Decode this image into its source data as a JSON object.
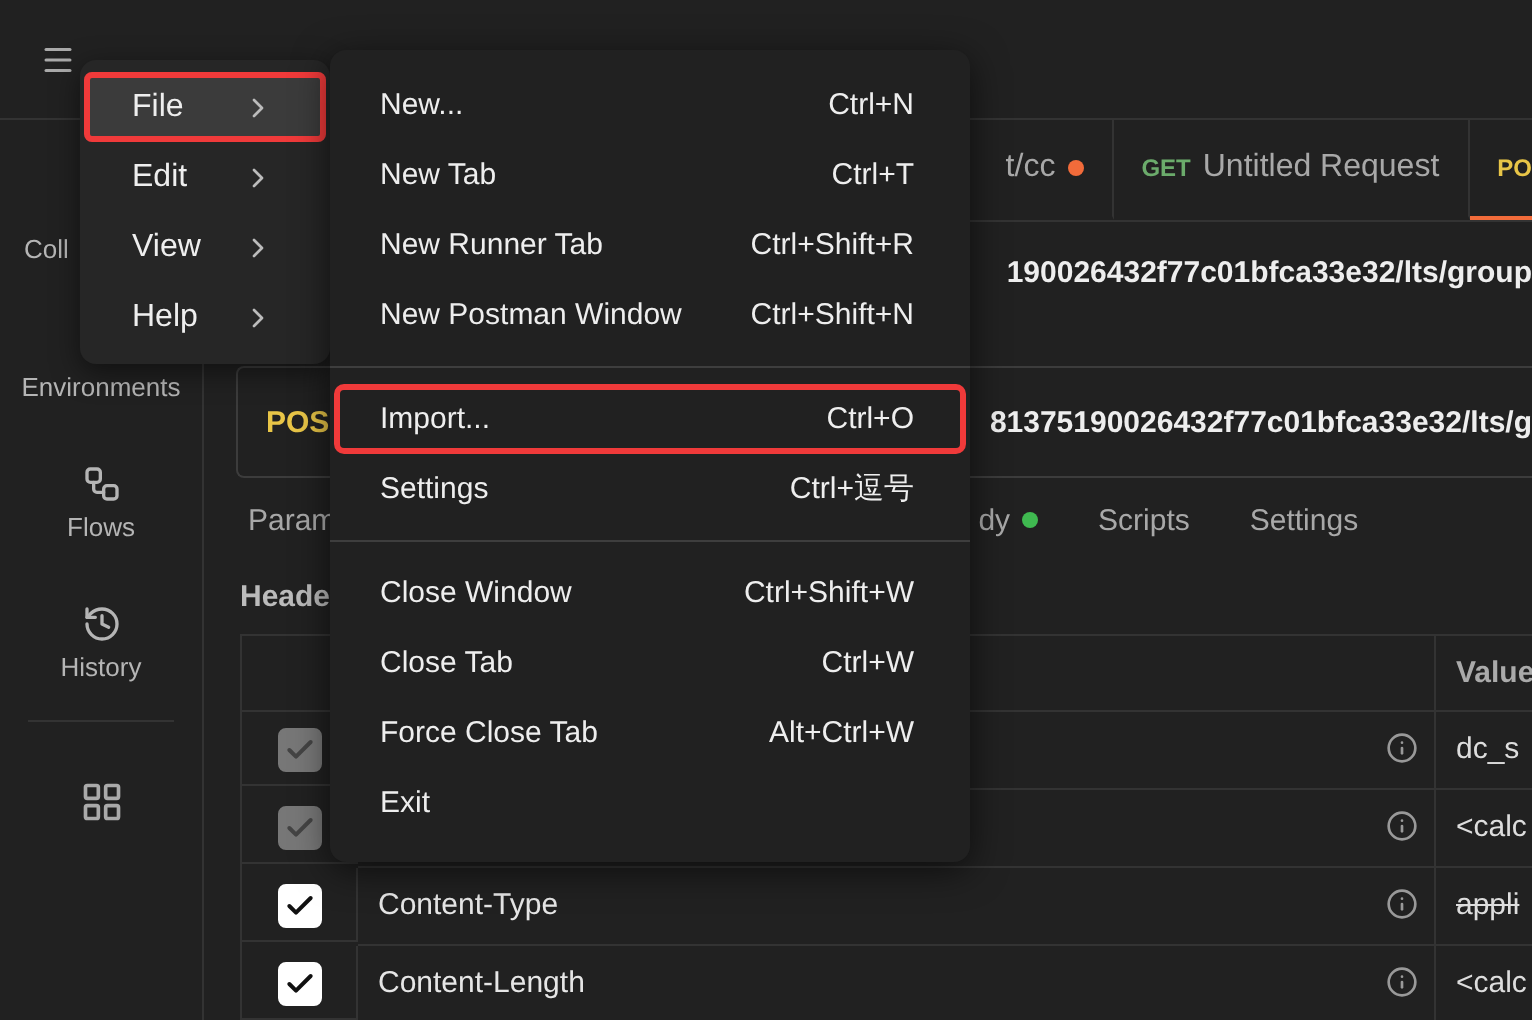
{
  "sidebar": {
    "items": [
      {
        "kind": "collections",
        "label": "Coll"
      },
      {
        "kind": "environments",
        "label": "Environments"
      },
      {
        "kind": "flows",
        "label": "Flows"
      },
      {
        "kind": "history",
        "label": "History"
      }
    ]
  },
  "request_tabs": [
    {
      "label": "t/cc",
      "unsaved": true,
      "selected": false
    },
    {
      "method": "GET",
      "color": "#6bab6b",
      "label": "Untitled Request",
      "unsaved": false,
      "selected": false
    },
    {
      "method": "PO",
      "color": "#e8c547",
      "selected": true
    }
  ],
  "url_rows": [
    {
      "url": "190026432f77c01bfca33e32/lts/group"
    },
    {
      "method": "POS",
      "url": "81375190026432f77c01bfca33e32/lts/g"
    }
  ],
  "request_sections": [
    {
      "label": "Param",
      "has_content": false
    },
    {
      "label": "dy",
      "has_content": true
    },
    {
      "label": "Scripts",
      "has_content": false
    },
    {
      "label": "Settings",
      "has_content": false
    }
  ],
  "headers": {
    "title": "Heade",
    "columns": [
      "Value"
    ],
    "rows": [
      {
        "checked": true,
        "disabled": true,
        "value": "dc_s",
        "overridden": false
      },
      {
        "checked": true,
        "disabled": true,
        "value": "<calc",
        "overridden": false
      },
      {
        "checked": true,
        "disabled": false,
        "key": "Content-Type",
        "value": "appli",
        "overridden": true
      },
      {
        "checked": true,
        "disabled": false,
        "key": "Content-Length",
        "value": "<calc",
        "overridden": false
      }
    ]
  },
  "app_menu": {
    "items": [
      {
        "label": "File",
        "selected": true,
        "highlighted": true
      },
      {
        "label": "Edit",
        "selected": false,
        "highlighted": false
      },
      {
        "label": "View",
        "selected": false,
        "highlighted": false
      },
      {
        "label": "Help",
        "selected": false,
        "highlighted": false
      }
    ]
  },
  "file_menu": {
    "groups": [
      [
        {
          "label": "New...",
          "shortcut": "Ctrl+N",
          "highlighted": false
        },
        {
          "label": "New Tab",
          "shortcut": "Ctrl+T",
          "highlighted": false
        },
        {
          "label": "New Runner Tab",
          "shortcut": "Ctrl+Shift+R",
          "highlighted": false
        },
        {
          "label": "New Postman Window",
          "shortcut": "Ctrl+Shift+N",
          "highlighted": false
        }
      ],
      [
        {
          "label": "Import...",
          "shortcut": "Ctrl+O",
          "highlighted": true
        },
        {
          "label": "Settings",
          "shortcut": "Ctrl+逗号",
          "highlighted": false
        }
      ],
      [
        {
          "label": "Close Window",
          "shortcut": "Ctrl+Shift+W",
          "highlighted": false
        },
        {
          "label": "Close Tab",
          "shortcut": "Ctrl+W",
          "highlighted": false
        },
        {
          "label": "Force Close Tab",
          "shortcut": "Alt+Ctrl+W",
          "highlighted": false
        },
        {
          "label": "Exit",
          "highlighted": false
        }
      ]
    ]
  }
}
